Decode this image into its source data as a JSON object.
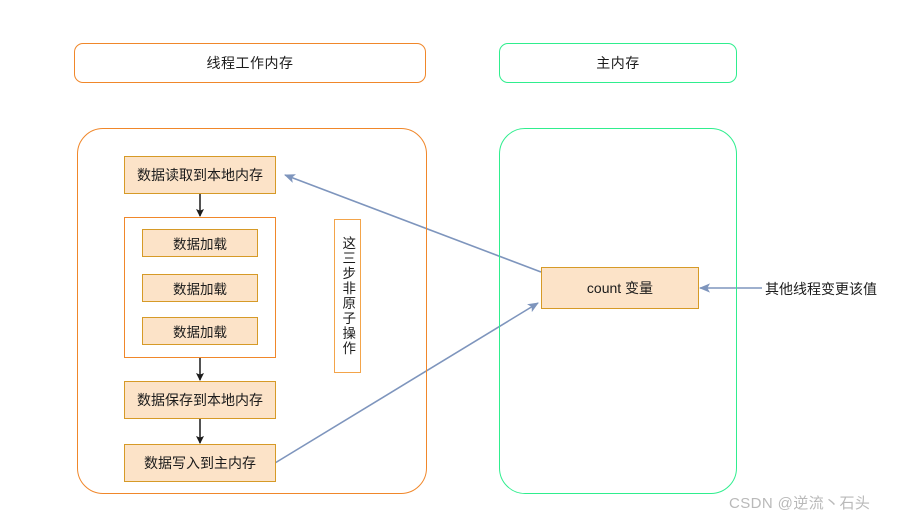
{
  "diagram": {
    "headers": [
      {
        "id": "thread-working-memory",
        "label": "线程工作内存"
      },
      {
        "id": "main-memory",
        "label": "主内存"
      }
    ],
    "thread_flow": {
      "steps": [
        {
          "id": "read-to-local",
          "label": "数据读取到本地内存"
        },
        {
          "id": "load-1",
          "label": "数据加载"
        },
        {
          "id": "load-2",
          "label": "数据加载"
        },
        {
          "id": "load-3",
          "label": "数据加载"
        },
        {
          "id": "save-to-local",
          "label": "数据保存到本地内存"
        },
        {
          "id": "write-to-main",
          "label": "数据写入到主内存"
        }
      ],
      "note": "这三步非原子操作"
    },
    "main_memory": {
      "variable_label": "count 变量"
    },
    "annotations": [
      {
        "id": "other-thread-change",
        "label": "其他线程变更该值"
      }
    ],
    "watermark": "CSDN @逆流丶石头",
    "colors": {
      "orange_border": "#f0872a",
      "green_border": "#2fee8e",
      "node_fill": "#fce3c8",
      "node_border": "#d69a27",
      "arrow_blue": "#7e95bd",
      "arrow_black": "#1b1b1b",
      "watermark_gray": "#b9b9b9"
    }
  }
}
